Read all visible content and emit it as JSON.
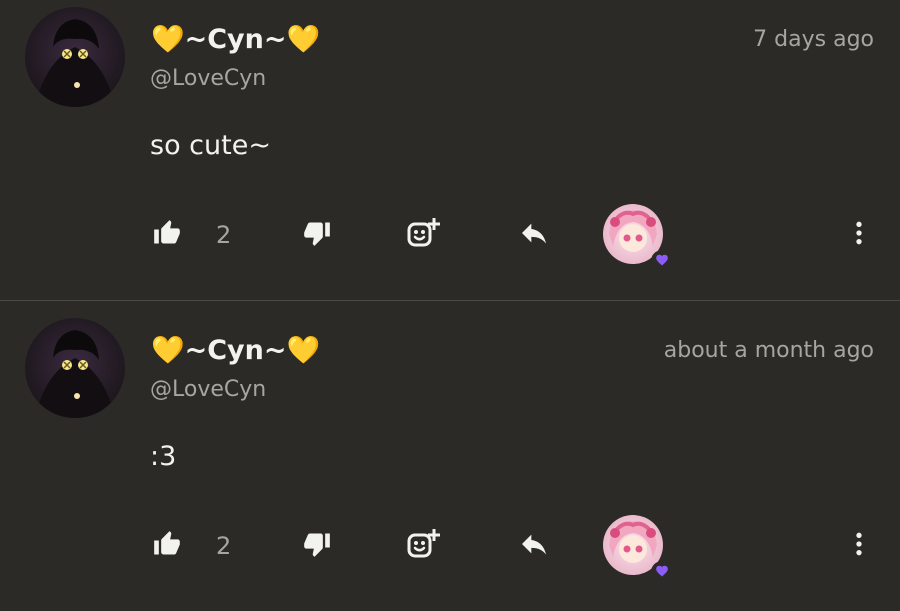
{
  "comments": [
    {
      "author": "💛~Cyn~💛",
      "handle": "@LoveCyn",
      "time": "7 days ago",
      "text": "so cute~",
      "likes": "2"
    },
    {
      "author": "💛~Cyn~💛",
      "handle": "@LoveCyn",
      "time": "about a month ago",
      "text": ":3",
      "likes": "2"
    }
  ],
  "colors": {
    "background": "#2b2a27",
    "primary_text": "#f2f2ef",
    "secondary_text": "#a6a59f",
    "heart_badge": "#8b5cf6"
  },
  "icons": [
    "avatar",
    "thumbs-up-icon",
    "thumbs-down-icon",
    "add-reaction-icon",
    "reply-icon",
    "creator-heart-avatar",
    "heart-icon",
    "more-vertical-icon"
  ]
}
